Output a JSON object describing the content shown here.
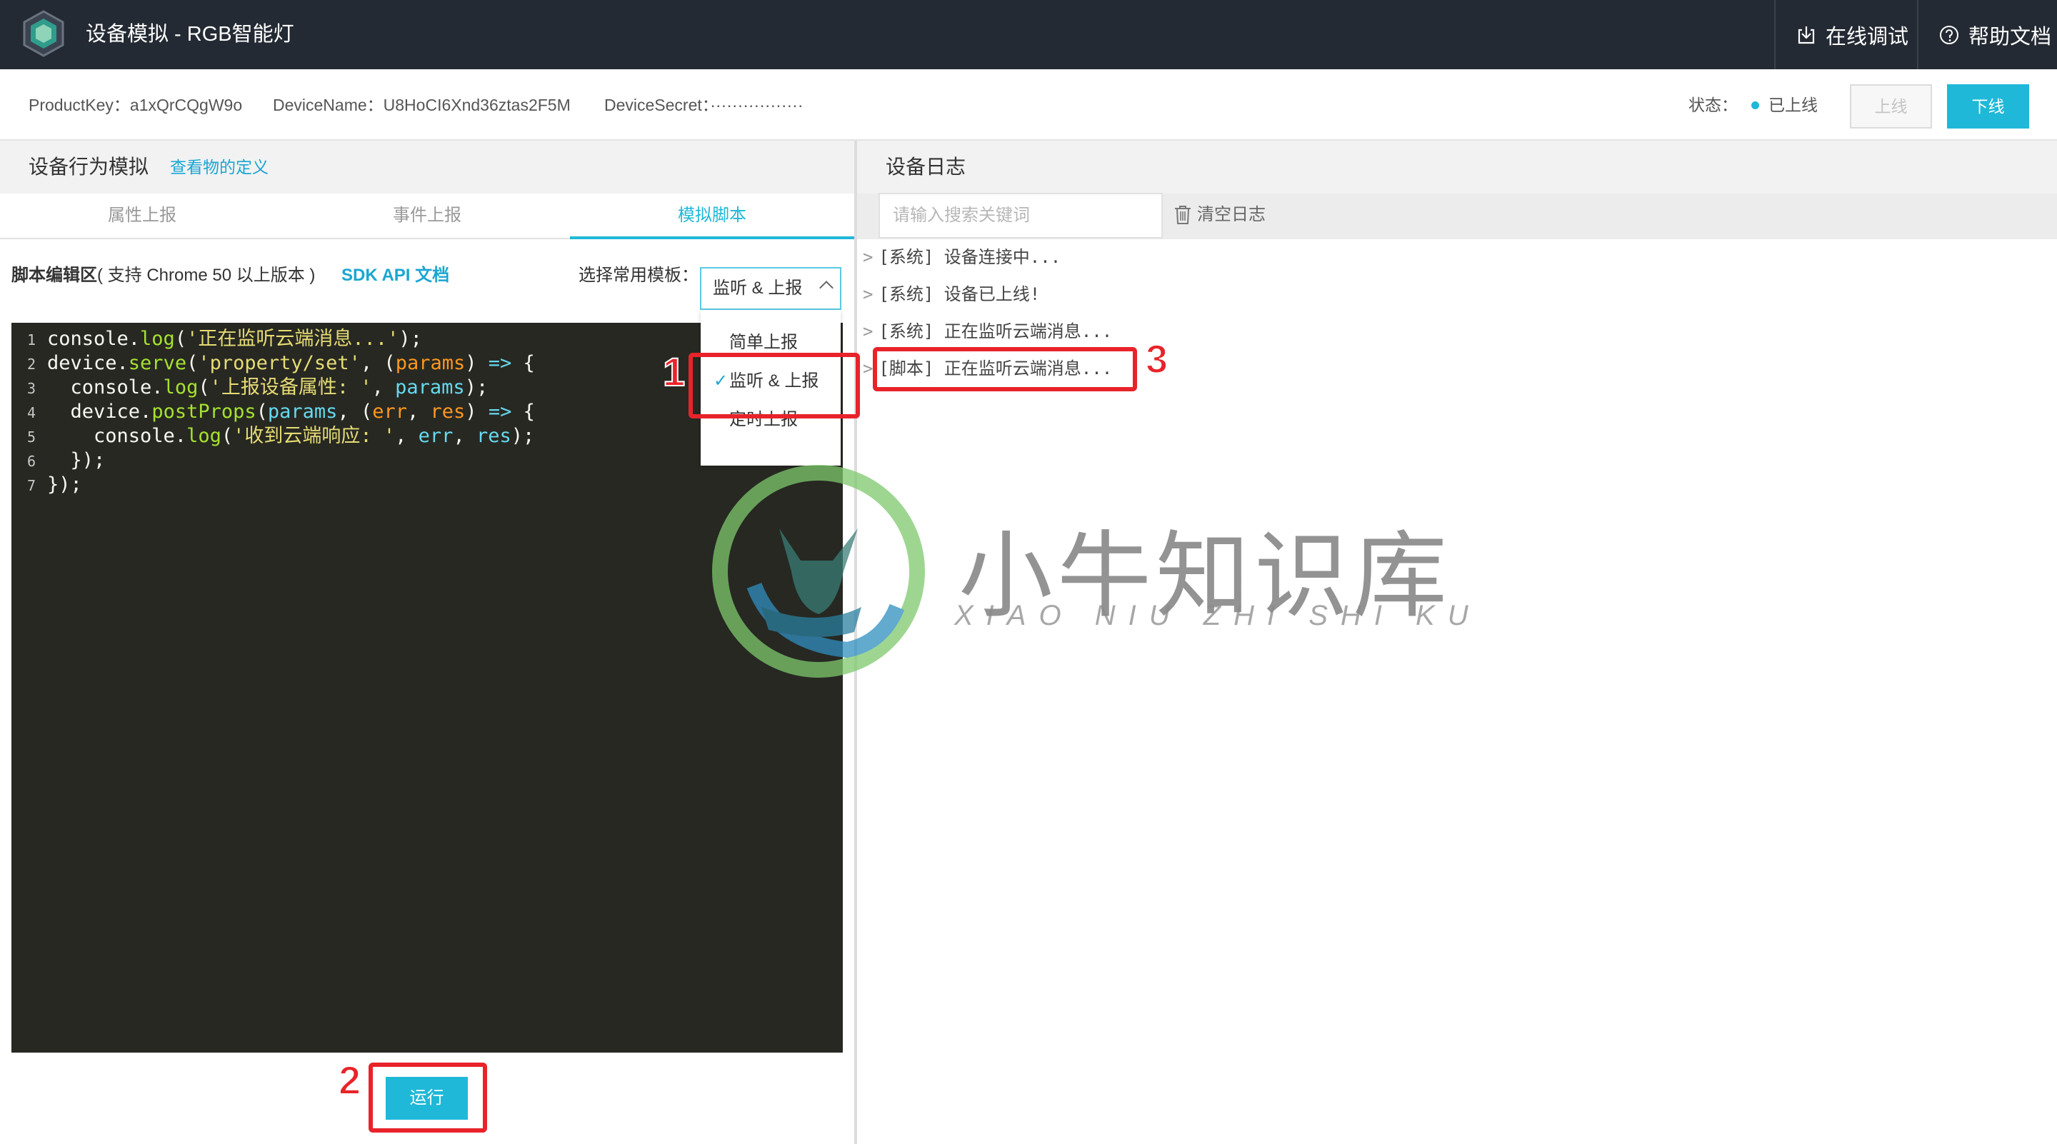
{
  "app": {
    "title": "设备模拟 - RGB智能灯",
    "debug_label": "在线调试",
    "help_label": "帮助文档"
  },
  "device": {
    "product_key": "ProductKey：a1xQrCQgW9o",
    "device_name": "DeviceName：U8HoCI6Xnd36ztas2F5M",
    "device_secret": "DeviceSecret：·················",
    "status_label": "状态：",
    "status_value": "已上线",
    "online_label": "上线",
    "offline_label": "下线"
  },
  "colors": {
    "accent": "#1fb8d8",
    "link": "#1aa6d3",
    "annotation": "#e8232a",
    "topbar": "#242a33"
  },
  "left": {
    "title": "设备行为模拟",
    "definition_link": "查看物的定义",
    "tabs": [
      "属性上报",
      "事件上报",
      "模拟脚本"
    ],
    "active_tab": "模拟脚本",
    "editor_label_bold": "脚本编辑区",
    "editor_label_rest": "( 支持 Chrome 50 以上版本 )",
    "sdk_link": "SDK API 文档",
    "template_label": "选择常用模板：",
    "template_selected": "监听 & 上报",
    "template_options": [
      "简单上报",
      "监听 & 上报",
      "定时上报"
    ],
    "run_label": "运行"
  },
  "code": [
    "console.log('正在监听云端消息...');",
    "device.serve('property/set', (params) => {",
    "  console.log('上报设备属性: ', params);",
    "  device.postProps(params, (err, res) => {",
    "    console.log('收到云端响应: ', err, res);",
    "  });",
    "});"
  ],
  "right": {
    "title": "设备日志",
    "search_placeholder": "请输入搜索关键词",
    "clear_label": "清空日志",
    "logs": [
      "[系统] 设备连接中...",
      "[系统] 设备已上线!",
      "[系统] 正在监听云端消息...",
      "[脚本] 正在监听云端消息..."
    ]
  },
  "annotations": [
    "1",
    "2",
    "3"
  ],
  "watermark": {
    "text": "小牛知识库",
    "sub": "XIAO NIU ZHI SHI KU"
  }
}
